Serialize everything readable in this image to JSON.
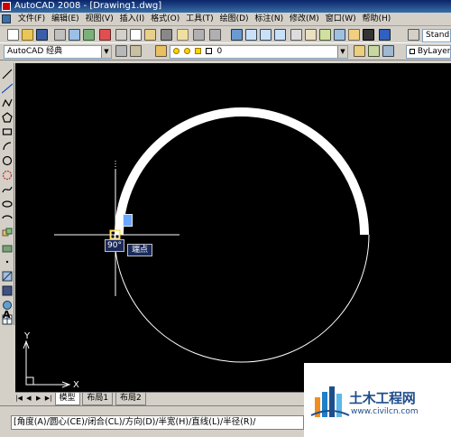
{
  "window": {
    "title": "AutoCAD 2008 - [Drawing1.dwg]"
  },
  "menu": [
    "文件(F)",
    "编辑(E)",
    "视图(V)",
    "插入(I)",
    "格式(O)",
    "工具(T)",
    "绘图(D)",
    "标注(N)",
    "修改(M)",
    "窗口(W)",
    "帮助(H)"
  ],
  "toolbar": {
    "workspace": "AutoCAD 经典",
    "layer": "0",
    "bylayer": "ByLayer",
    "text_style": "Stand"
  },
  "canvas": {
    "angle_tooltip": "90°",
    "snap_tooltip": "端点",
    "axis_x": "X",
    "axis_y": "Y"
  },
  "tabs": [
    "模型",
    "布局1",
    "布局2"
  ],
  "command_line": "[角度(A)/圆心(CE)/闭合(CL)/方向(D)/半宽(H)/直线(L)/半径(R)/",
  "watermark": {
    "brand": "土木工程网",
    "url": "www.civilcn.com"
  },
  "colors": {
    "canvas_bg": "#000000",
    "title_bg": "#0a246a",
    "tooltip_bg": "#1a2a5a"
  }
}
